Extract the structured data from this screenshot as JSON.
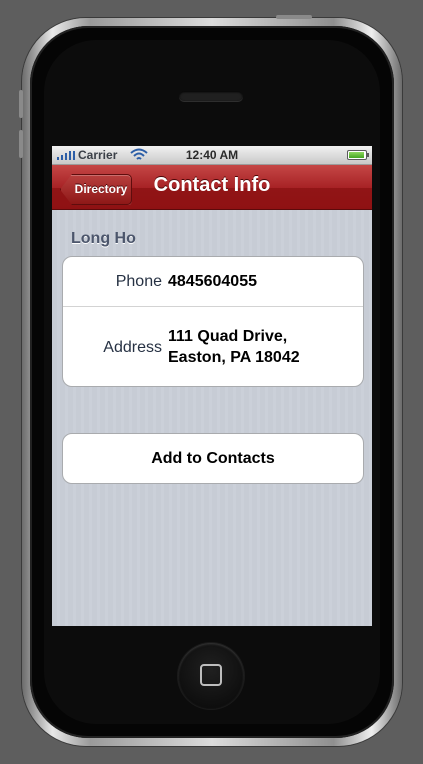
{
  "status_bar": {
    "carrier": "Carrier",
    "time": "12:40 AM"
  },
  "nav_bar": {
    "back_label": "Directory",
    "title": "Contact Info"
  },
  "contact": {
    "name": "Long Ho",
    "phone_label": "Phone",
    "phone_value": "4845604055",
    "address_label": "Address",
    "address_line1": "111 Quad Drive,",
    "address_line2": "Easton, PA 18042"
  },
  "actions": {
    "add_to_contacts": "Add to Contacts"
  },
  "colors": {
    "nav_bar": "#a72225",
    "background_stripes": "#c7ccd5",
    "section_header": "#4c566c",
    "battery": "#44a521"
  },
  "icons": {
    "signal": "signal-bars-icon",
    "wifi": "wifi-icon",
    "battery": "battery-icon",
    "home": "home-button-icon"
  }
}
